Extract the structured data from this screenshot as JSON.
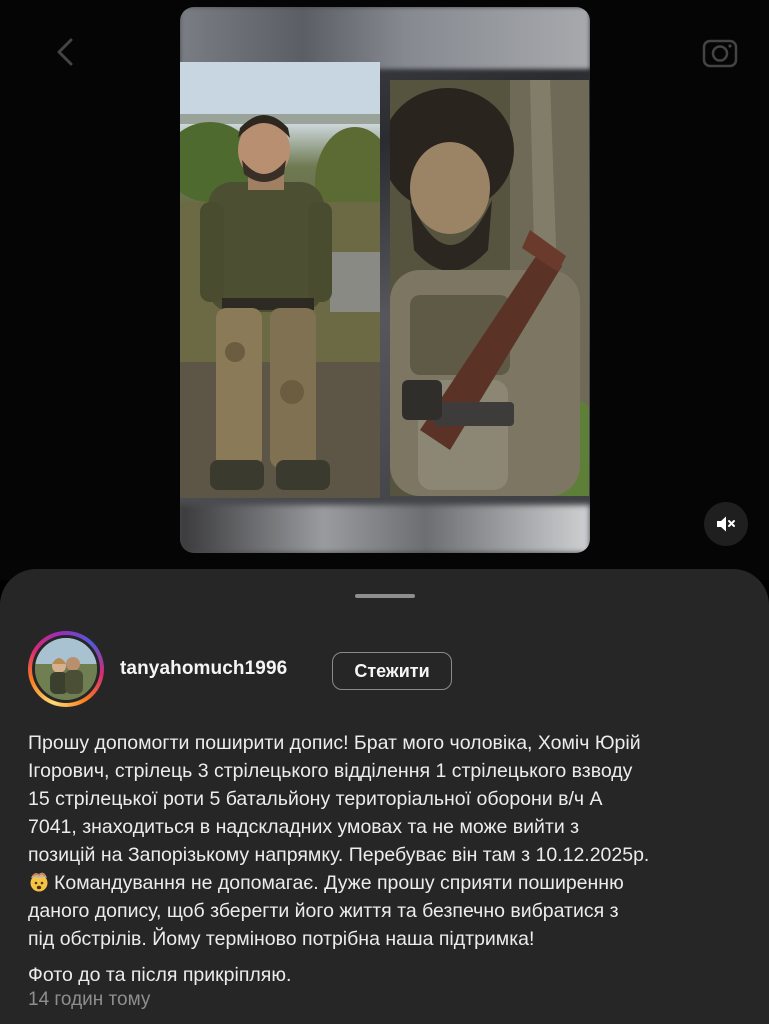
{
  "post": {
    "username": "tanyahomuch1996",
    "follow_label": "Стежити",
    "caption_lines": [
      "Прошу допомогти поширити допис! Брат мого чоловіка, Хоміч Юрій",
      "Ігорович, стрілець 3 стрілецького відділення 1 стрілецького взводу",
      "15  стрілецької роти 5 батальйону територіальної оборони в/ч А",
      "7041, знаходиться в надскладних умовах та не може вийти з",
      "позицій на Запорізькому напрямку. Перебуває він там з 10.12.2025р.",
      "Командування не допомагає. Дуже прошу сприяти поширенню",
      "даного допису, щоб зберегти його життя та безпечно вибратися з",
      "під обстрілів. Йому терміново потрібна наша підтримка!"
    ],
    "caption_emoji": "exploding-head-emoji",
    "caption_p2": "Фото до та після прикріпляю.",
    "timestamp": "14 годин тому"
  },
  "icons": {
    "back": "chevron-left-icon",
    "camera": "camera-icon",
    "mute": "speaker-muted-icon"
  },
  "colors": {
    "sheet_bg": "#262626",
    "text_primary": "#f5f5f5",
    "text_secondary": "#8e8e8e"
  }
}
